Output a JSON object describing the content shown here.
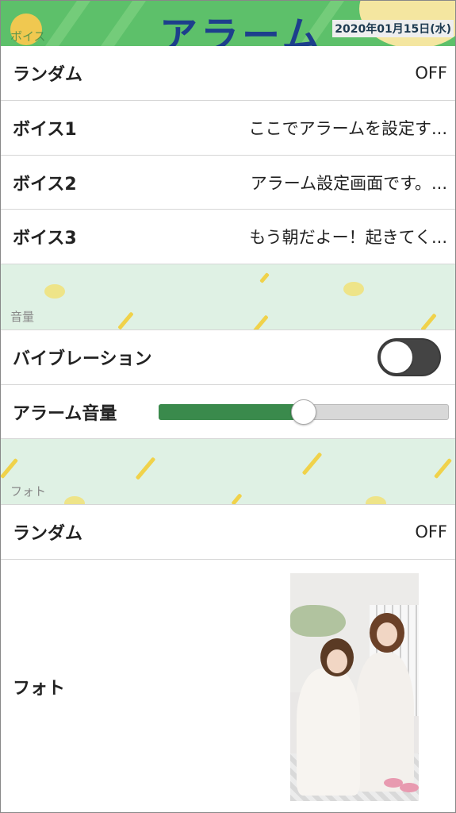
{
  "header": {
    "title": "アラーム",
    "date": "2020年01月15日(水)",
    "section_ghost": "ボイス"
  },
  "voice_section": {
    "rows": [
      {
        "label": "ランダム",
        "value": "OFF"
      },
      {
        "label": "ボイス1",
        "value": "ここでアラームを設定す..."
      },
      {
        "label": "ボイス2",
        "value": "アラーム設定画面です。..."
      },
      {
        "label": "ボイス3",
        "value": "もう朝だよー！起きてく..."
      }
    ]
  },
  "volume_section": {
    "label": "音量",
    "vibration_label": "バイブレーション",
    "vibration_on": false,
    "alarm_volume_label": "アラーム音量",
    "alarm_volume_level": 0.5
  },
  "photo_section": {
    "label": "フォト",
    "random_label": "ランダム",
    "random_value": "OFF",
    "photo_label": "フォト",
    "photo_description": "photo-thumbnail"
  },
  "colors": {
    "header_green": "#5dc06a",
    "section_bg": "#dff1e4",
    "slider_fill": "#3a8a4c",
    "toggle_off": "#444444"
  }
}
